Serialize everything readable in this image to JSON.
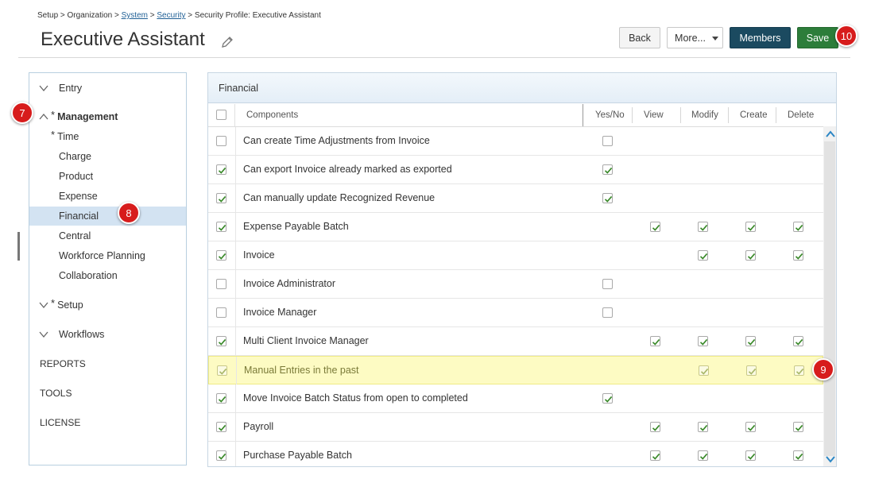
{
  "breadcrumb": {
    "p1": "Setup > Organization > ",
    "l1": "System",
    "p2": " > ",
    "l2": "Security",
    "p3": " > Security Profile: Executive Assistant"
  },
  "title": "Executive Assistant",
  "buttons": {
    "back": "Back",
    "more": "More...",
    "members": "Members",
    "save": "Save"
  },
  "callouts": {
    "c7": "7",
    "c8": "8",
    "c9": "9",
    "c10": "10"
  },
  "sidebar": {
    "entry": "Entry",
    "management": "Management",
    "sub": [
      "Time",
      "Charge",
      "Product",
      "Expense",
      "Financial",
      "Central",
      "Workforce Planning",
      "Collaboration"
    ],
    "setup": "Setup",
    "workflows": "Workflows",
    "reports": "REPORTS",
    "tools": "TOOLS",
    "license": "LICENSE",
    "star": "*"
  },
  "panel": {
    "title": "Financial",
    "columns": {
      "components": "Components",
      "yesno": "Yes/No",
      "view": "View",
      "modify": "Modify",
      "create": "Create",
      "delete": "Delete"
    }
  },
  "rows": [
    {
      "label": "Can create Time Adjustments from Invoice",
      "selected": false,
      "yesno": false
    },
    {
      "label": "Can export Invoice already marked as exported",
      "selected": true,
      "yesno": true
    },
    {
      "label": "Can manually update Recognized Revenue",
      "selected": true,
      "yesno": true
    },
    {
      "label": "Expense Payable Batch",
      "selected": true,
      "view": true,
      "modify": true,
      "create": true,
      "delete": true
    },
    {
      "label": "Invoice",
      "selected": true,
      "modify": true,
      "create": true,
      "delete": true
    },
    {
      "label": "Invoice Administrator",
      "selected": false,
      "yesno": false
    },
    {
      "label": "Invoice Manager",
      "selected": false,
      "yesno": false
    },
    {
      "label": "Multi Client Invoice Manager",
      "selected": true,
      "view": true,
      "modify": true,
      "create": true,
      "delete": true
    },
    {
      "label": "Manual Entries in the past",
      "selected": true,
      "modify": true,
      "create": true,
      "delete": true,
      "highlight": true
    },
    {
      "label": "Move Invoice Batch Status from open to completed",
      "selected": true,
      "yesno": true
    },
    {
      "label": "Payroll",
      "selected": true,
      "view": true,
      "modify": true,
      "create": true,
      "delete": true
    },
    {
      "label": "Purchase Payable Batch",
      "selected": true,
      "view": true,
      "modify": true,
      "create": true,
      "delete": true
    }
  ],
  "colors": {
    "accent": "#1b4a60",
    "save": "#2c7d3a",
    "check": "#3a8a2a",
    "callout": "#d71c1c",
    "selected": "#d3e3f2",
    "highlight": "#fdfbc3"
  }
}
